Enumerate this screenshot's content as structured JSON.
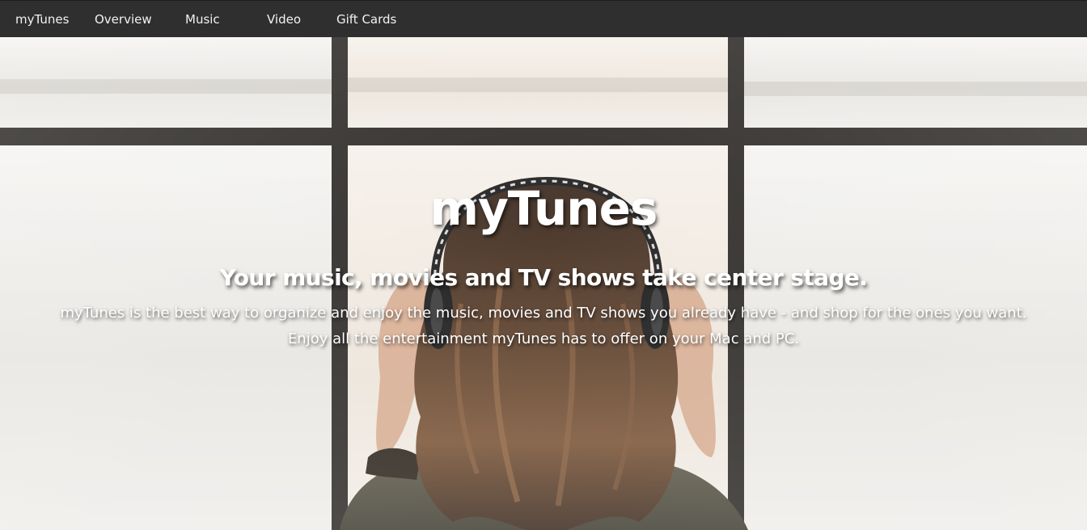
{
  "nav": {
    "brand": "myTunes",
    "items": [
      {
        "label": "Overview"
      },
      {
        "label": "Music"
      },
      {
        "label": "Video"
      },
      {
        "label": "Gift Cards"
      }
    ]
  },
  "hero": {
    "title": "myTunes",
    "subtitle": "Your music, movies and TV shows take center stage.",
    "body_line1": "myTunes is the best way to organize and enjoy the music, movies and TV shows you already have - and shop for the ones you want.",
    "body_line2": "Enjoy all the entertainment myTunes has to offer on your Mac and PC."
  },
  "colors": {
    "navbar_background": "#2f2f2f",
    "nav_text": "#f2f2f2",
    "hero_text": "#ffffff"
  }
}
